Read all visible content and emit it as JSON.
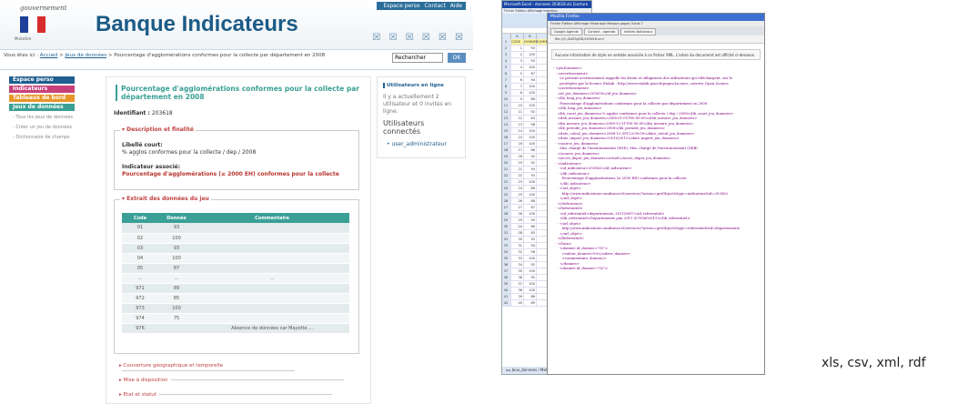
{
  "site": {
    "logo_text": "gouvernement",
    "logo_sub": "Ministère",
    "title": "Banque Indicateurs",
    "top_links": [
      "Espace perso",
      "Contact",
      "Aide"
    ],
    "header_glyphs": "☒ ☒ ☒ ☒ ☒ ☒"
  },
  "breadcrumb": {
    "prefix": "Vous êtes ici :",
    "home": "Accueil",
    "sep1": ">",
    "jeux": "Jeux de données",
    "sep2": ">",
    "current": "Pourcentage d'agglomérations conformes pour la collecte par département en 2008"
  },
  "search": {
    "value": "Rechercher",
    "button": "OK"
  },
  "nav": {
    "items": [
      {
        "label": "Espace perso",
        "color": "#1f5f90"
      },
      {
        "label": "Indicateurs",
        "color": "#c8407a"
      },
      {
        "label": "Tableaux de bord",
        "color": "#e8962a"
      },
      {
        "label": "Jeux de données",
        "color": "#3aa095"
      }
    ],
    "sub": [
      "- Tous les jeux de données",
      "- Créer un jeu de données",
      "- Dictionnaire de champs"
    ]
  },
  "main": {
    "title": "Pourcentage d'agglomérations conformes pour la collecte par département en 2008",
    "ident_label": "Identifiant :",
    "ident_value": "203618",
    "desc_legend": "Description et finalité",
    "libelle_label": "Libellé court:",
    "libelle_value": "% agglos conformes pour la collecte / dep / 2008",
    "assoc_label": "Indicateur associé:",
    "assoc_value": "Pourcentage d'agglomérations (≥ 2000 EH) conformes pour la collecte",
    "extrait_legend": "Extrait des données du jeu",
    "table": {
      "headers": [
        "Code",
        "Donnée",
        "Commentaire"
      ],
      "rows": [
        [
          "01",
          "93",
          ""
        ],
        [
          "02",
          "100",
          ""
        ],
        [
          "03",
          "93",
          ""
        ],
        [
          "04",
          "100",
          ""
        ],
        [
          "05",
          "87",
          ""
        ],
        [
          "...",
          "...",
          "..."
        ],
        [
          "971",
          "89",
          ""
        ],
        [
          "972",
          "85",
          ""
        ],
        [
          "973",
          "100",
          ""
        ],
        [
          "974",
          "75",
          ""
        ],
        [
          "976",
          "",
          "Absence de données car Mayotte ..."
        ]
      ]
    },
    "sections": [
      "Couverture géographique et temporelle",
      "Mise à disposition",
      "Etat et statut"
    ]
  },
  "sidebar": {
    "heading": "Utilisateurs en ligne",
    "text": "Il y a actuellement 2 utilisateur et 0 invités en ligne.",
    "h2": "Utilisateurs connectés",
    "user": "user_administrateur"
  },
  "excel": {
    "title": "Microsoft Excel - donnees 203618.xls [Lecture seule]",
    "menu": "Fichier Edition Affichage Insertion",
    "cols": [
      "",
      "A",
      "B",
      "C"
    ],
    "header_row": [
      "1",
      "CODE",
      "DONNEE",
      "COMMENTAIRE"
    ],
    "rows": [
      [
        "2",
        "1",
        "93"
      ],
      [
        "3",
        "2",
        "100"
      ],
      [
        "4",
        "3",
        "93"
      ],
      [
        "5",
        "4",
        "100"
      ],
      [
        "6",
        "5",
        "87"
      ],
      [
        "7",
        "6",
        "94"
      ],
      [
        "8",
        "7",
        "100"
      ],
      [
        "9",
        "8",
        "100"
      ],
      [
        "10",
        "9",
        "88"
      ],
      [
        "11",
        "10",
        "100"
      ],
      [
        "12",
        "11",
        "92"
      ],
      [
        "13",
        "12",
        "83"
      ],
      [
        "14",
        "13",
        "96"
      ],
      [
        "15",
        "14",
        "100"
      ],
      [
        "16",
        "15",
        "100"
      ],
      [
        "17",
        "16",
        "100"
      ],
      [
        "18",
        "17",
        "86"
      ],
      [
        "19",
        "18",
        "92"
      ],
      [
        "20",
        "19",
        "92"
      ],
      [
        "21",
        "21",
        "94"
      ],
      [
        "22",
        "22",
        "93"
      ],
      [
        "23",
        "23",
        "100"
      ],
      [
        "24",
        "24",
        "86"
      ],
      [
        "25",
        "25",
        "100"
      ],
      [
        "26",
        "26",
        "88"
      ],
      [
        "27",
        "27",
        "87"
      ],
      [
        "28",
        "28",
        "100"
      ],
      [
        "29",
        "29",
        "90"
      ],
      [
        "30",
        "2A",
        "86"
      ],
      [
        "31",
        "2B",
        "83"
      ],
      [
        "32",
        "30",
        "92"
      ],
      [
        "33",
        "31",
        "94"
      ],
      [
        "34",
        "32",
        "96"
      ],
      [
        "35",
        "33",
        "100"
      ],
      [
        "36",
        "34",
        "92"
      ],
      [
        "37",
        "35",
        "100"
      ],
      [
        "38",
        "36",
        "95"
      ],
      [
        "39",
        "37",
        "100"
      ],
      [
        "40",
        "38",
        "100"
      ],
      [
        "41",
        "39",
        "86"
      ],
      [
        "42",
        "40",
        "89"
      ]
    ],
    "sheet_tab": "Jeux_donnees / Metadonnees"
  },
  "firefox": {
    "title": "Mozilla Firefox",
    "menu": "Fichier Édition Affichage Historique Marque-pages Outils ?",
    "tabs": [
      "Google Agenda",
      "Contact - agenda",
      "Indices Nationaux"
    ],
    "url": "file:///C:/DATA/JDD/203618.xml",
    "info": "Aucune information de style ne semble associée à ce fichier XML. L'arbre du document est affiché ci-dessous.",
    "xml_lines": [
      "- <jeuDonnees>",
      "  - <avertissement>",
      "      Le présent avertissement rappelle les droits et obligations des utilisateurs qui téléchargent, sur le",
      "      protégées par la licence Etalab : http://www.etalab.gouv.fr/pages/Licence_ouverte_Open_licence",
      "    </avertissement>",
      "    <id_jeu_donnees>203618</id_jeu_donnees>",
      "  - <lib_long_jeu_donnees>",
      "      Pourcentage d'agglomérations conformes pour la collecte par département en 2008",
      "    </lib_long_jeu_donnees>",
      "    <lib_court_jeu_donnees>% agglos conformes pour la collecte / dep / 2008</lib_court_jeu_donnees>",
      "    <deb_mesure_jeu_donnees>2008-01-01T00:00:00</deb_mesure_jeu_donnees>",
      "    <fin_mesure_jeu_donnees>2008-12-31T00:00:00</fin_mesure_jeu_donnees>",
      "    <lib_periode_jeu_donnees>2008</lib_periode_jeu_donnees>",
      "    <date_calcul_jeu_donnees>2008-12-30T23:00:00</date_calcul_jeu_donnees>",
      "    <date_import_jeu_donnees>29/10/2012</date_import_jeu_donnees>",
      "  - <source_jeu_donnees>",
      "      Min. chargé de l'environnement (SNE), Min. chargé de l'environnement (DEB)",
      "    </source_jeu_donnees>",
      "    <acces_depot_jeu_donnees>actuel</acces_depot_jeu_donnees>",
      "  - <Indicateur>",
      "      <id_indicateur>203562</id_indicateur>",
      "    - <lib_indicateur>",
      "        Pourcentage d'agglomérations (≥ 2000 EH) conformes pour la collecte",
      "      </lib_indicateur>",
      "    - <url_objet>",
      "        http://www.indicateurs.eaufrance.fr/services/?action=getObject&type=indicateur&id=203562",
      "      </url_objet>",
      "    </Indicateur>",
      "  - <Referentiel>",
      "      <id_referentiel>departements_2011/0607</id_referentiel>",
      "      <lib_referentiel>Départements juin 2011 (0700602011)</lib_referentiel>",
      "    - <url_objet>",
      "        http://www.indicateurs.eaufrance.fr/services/?action=getObject&type=referentiel&id=departements",
      "      </url_objet>",
      "    </Referentiel>",
      "  - <Data>",
      "    - <donnee id_donnee=\"01\">",
      "        <valeur_donnee>93</valeur_donnee>",
      "        <commentaire_donnee/>",
      "      </donnee>",
      "    - <donnee id_donnee=\"02\">"
    ]
  },
  "formats_caption": "xls, csv, xml, rdf"
}
